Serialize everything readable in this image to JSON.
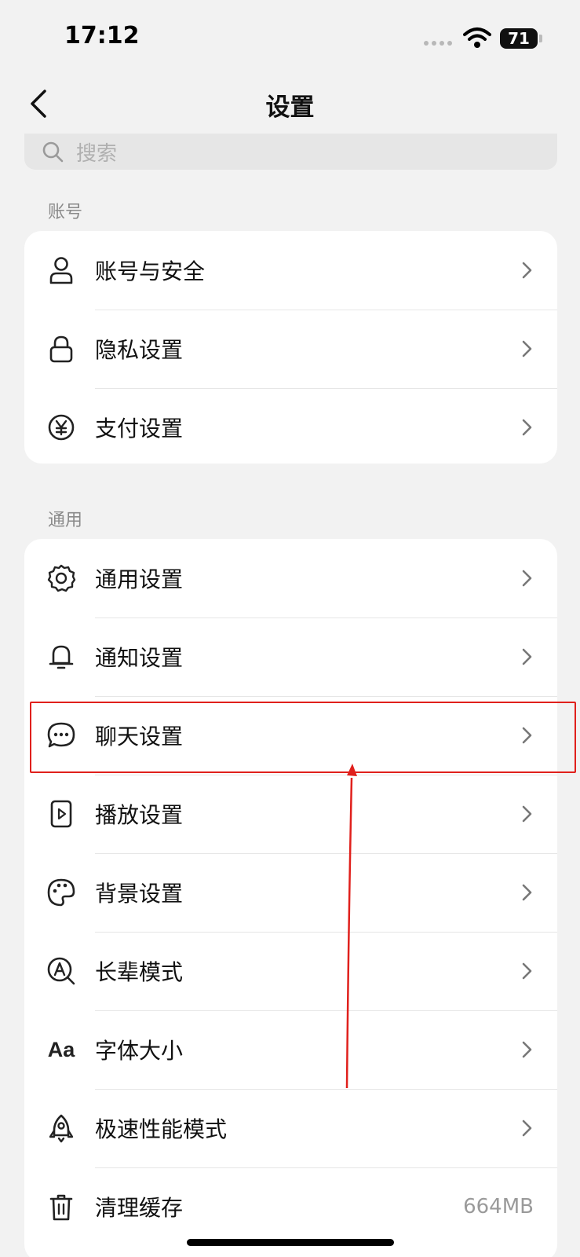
{
  "status_bar": {
    "time": "17:12",
    "battery": "71"
  },
  "nav": {
    "title": "设置"
  },
  "search": {
    "placeholder": "搜索"
  },
  "sections": [
    {
      "label": "账号",
      "items": [
        {
          "label": "账号与安全",
          "icon": "person-icon"
        },
        {
          "label": "隐私设置",
          "icon": "lock-icon"
        },
        {
          "label": "支付设置",
          "icon": "yen-icon"
        }
      ]
    },
    {
      "label": "通用",
      "items": [
        {
          "label": "通用设置",
          "icon": "gear-icon"
        },
        {
          "label": "通知设置",
          "icon": "bell-icon"
        },
        {
          "label": "聊天设置",
          "icon": "chat-bubble-icon"
        },
        {
          "label": "播放设置",
          "icon": "play-icon"
        },
        {
          "label": "背景设置",
          "icon": "palette-icon"
        },
        {
          "label": "长辈模式",
          "icon": "elder-mode-icon"
        },
        {
          "label": "字体大小",
          "icon": "font-size-icon",
          "icon_text": "Aa"
        },
        {
          "label": "极速性能模式",
          "icon": "rocket-icon"
        },
        {
          "label": "清理缓存",
          "icon": "trash-icon",
          "value": "664MB"
        }
      ]
    }
  ],
  "colors": {
    "highlight": "#e0201c",
    "background": "#f2f2f2"
  }
}
